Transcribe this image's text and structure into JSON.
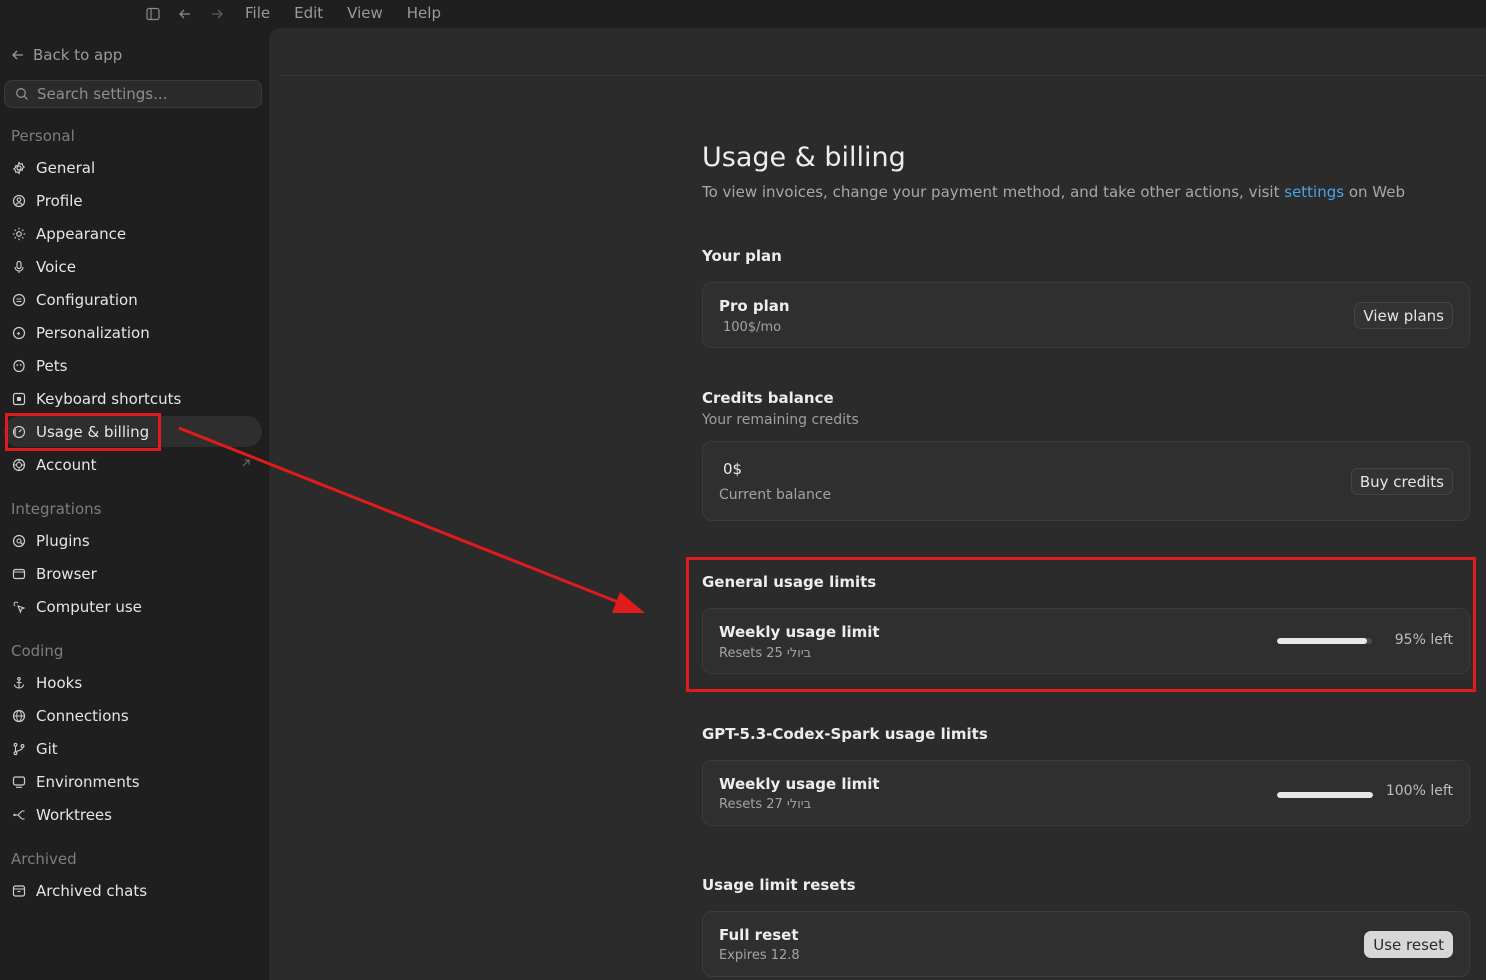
{
  "menubar": {
    "icons": [
      "sidebar-toggle-icon",
      "arrow-left-icon",
      "arrow-right-icon"
    ],
    "menus": [
      "File",
      "Edit",
      "View",
      "Help"
    ]
  },
  "sidebar": {
    "back_label": "Back to app",
    "search_placeholder": "Search settings...",
    "sections": [
      {
        "title": "Personal",
        "items": [
          {
            "label": "General",
            "icon": "gear-icon"
          },
          {
            "label": "Profile",
            "icon": "user-circle-icon"
          },
          {
            "label": "Appearance",
            "icon": "sun-icon"
          },
          {
            "label": "Voice",
            "icon": "microphone-icon"
          },
          {
            "label": "Configuration",
            "icon": "sliders-icon"
          },
          {
            "label": "Personalization",
            "icon": "sparkle-circle-icon"
          },
          {
            "label": "Pets",
            "icon": "paw-icon"
          },
          {
            "label": "Keyboard shortcuts",
            "icon": "keyboard-icon"
          },
          {
            "label": "Usage & billing",
            "icon": "gauge-icon",
            "active": true
          },
          {
            "label": "Account",
            "icon": "account-icon",
            "external": true
          }
        ]
      },
      {
        "title": "Integrations",
        "items": [
          {
            "label": "Plugins",
            "icon": "plug-icon"
          },
          {
            "label": "Browser",
            "icon": "browser-icon"
          },
          {
            "label": "Computer use",
            "icon": "cursor-icon"
          }
        ]
      },
      {
        "title": "Coding",
        "items": [
          {
            "label": "Hooks",
            "icon": "anchor-icon"
          },
          {
            "label": "Connections",
            "icon": "globe-icon"
          },
          {
            "label": "Git",
            "icon": "git-branch-icon"
          },
          {
            "label": "Environments",
            "icon": "monitor-icon"
          },
          {
            "label": "Worktrees",
            "icon": "worktree-icon"
          }
        ]
      },
      {
        "title": "Archived",
        "items": [
          {
            "label": "Archived chats",
            "icon": "archive-icon"
          }
        ]
      }
    ]
  },
  "main": {
    "title": "Usage & billing",
    "subtitle_before": "To view invoices, change your payment method, and take other actions, visit ",
    "subtitle_link": "settings",
    "subtitle_after": " on Web",
    "plan": {
      "section_label": "Your plan",
      "name": "Pro plan",
      "price": "100$/mo",
      "button": "View plans"
    },
    "credits": {
      "section_label": "Credits balance",
      "section_sub": "Your remaining credits",
      "amount": "0$",
      "caption": "Current balance",
      "button": "Buy credits"
    },
    "general_limits": {
      "section_label": "General usage limits",
      "title": "Weekly usage limit",
      "resets": "Resets 25 ביולי",
      "percent_text": "95% left",
      "fraction_left": 0.95
    },
    "spark_limits": {
      "section_label": "GPT-5.3-Codex-Spark usage limits",
      "title": "Weekly usage limit",
      "resets": "Resets 27 ביולי",
      "percent_text": "100% left",
      "fraction_left": 1.0
    },
    "resets": {
      "section_label": "Usage limit resets",
      "title": "Full reset",
      "expires": "Expires 12.8",
      "button": "Use reset"
    }
  },
  "colors": {
    "accent_link": "#4aa3e8",
    "annotation": "#e01b1b"
  }
}
